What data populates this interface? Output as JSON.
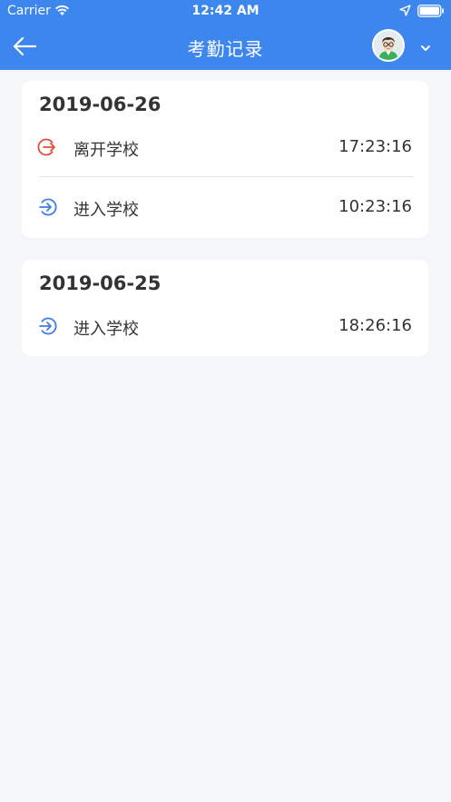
{
  "status_bar": {
    "carrier": "Carrier",
    "time": "12:42 AM",
    "icons": [
      "wifi-icon",
      "location-icon",
      "battery-icon"
    ]
  },
  "header": {
    "title": "考勤记录",
    "back_icon": "arrow-left-icon",
    "dropdown_icon": "chevron-down-icon",
    "background_color": "#3d86ee"
  },
  "records": [
    {
      "date": "2019-06-26",
      "entries": [
        {
          "label": "离开学校",
          "time": "17:23:16",
          "type": "leave",
          "icon": "exit-icon",
          "color": "#e84c3d"
        },
        {
          "label": "进入学校",
          "time": "10:23:16",
          "type": "enter",
          "icon": "enter-icon",
          "color": "#3d7fe0"
        }
      ]
    },
    {
      "date": "2019-06-25",
      "entries": [
        {
          "label": "进入学校",
          "time": "18:26:16",
          "type": "enter",
          "icon": "enter-icon",
          "color": "#3d7fe0"
        }
      ]
    }
  ]
}
